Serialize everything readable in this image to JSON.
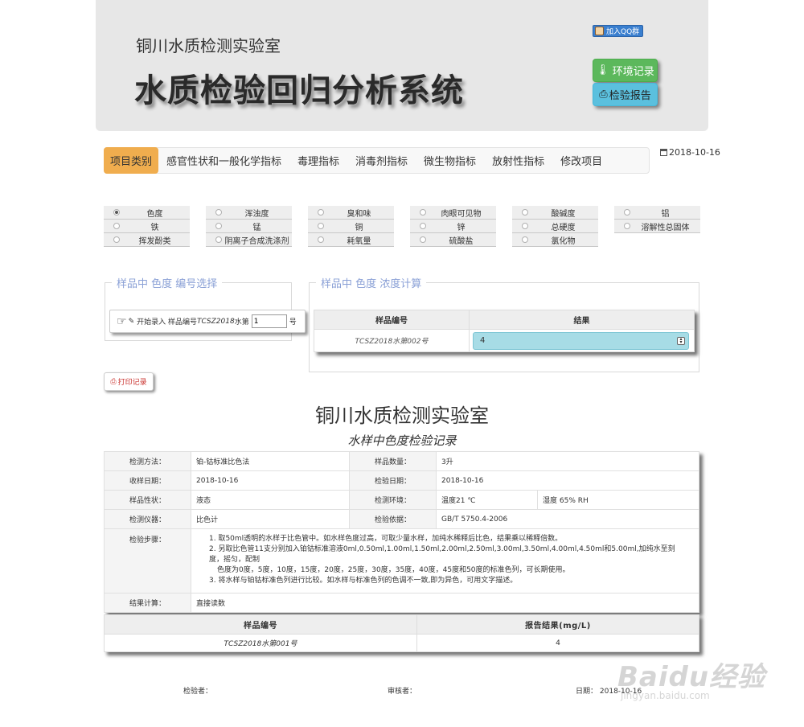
{
  "header": {
    "lab_name": "铜川水质检测实验室",
    "system_title": "水质检验回归分析系统",
    "qq_button": "加入QQ群",
    "env_button": "环境记录",
    "report_button": "检验报告"
  },
  "tabs": {
    "active": "项目类别",
    "items": [
      "感官性状和一般化学指标",
      "毒理指标",
      "消毒剂指标",
      "微生物指标",
      "放射性指标",
      "修改项目"
    ]
  },
  "date_top": "2018-10-16",
  "radio_items": [
    {
      "label": "色度",
      "checked": true
    },
    {
      "label": "浑浊度",
      "checked": false
    },
    {
      "label": "臭和味",
      "checked": false
    },
    {
      "label": "肉眼可见物",
      "checked": false
    },
    {
      "label": "酸碱度",
      "checked": false
    },
    {
      "label": "铝",
      "checked": false
    },
    {
      "label": "铁",
      "checked": false
    },
    {
      "label": "锰",
      "checked": false
    },
    {
      "label": "铜",
      "checked": false
    },
    {
      "label": "锌",
      "checked": false
    },
    {
      "label": "总硬度",
      "checked": false
    },
    {
      "label": "溶解性总固体",
      "checked": false
    },
    {
      "label": "挥发酚类",
      "checked": false
    },
    {
      "label": "阴离子合成洗涤剂",
      "checked": false
    },
    {
      "label": "耗氧量",
      "checked": false
    },
    {
      "label": "硫酸盐",
      "checked": false
    },
    {
      "label": "氯化物",
      "checked": false
    }
  ],
  "select_panel": {
    "legend": "样品中 色度 编号选择",
    "prefix": "开始录入 样品编号",
    "sample_prefix": "TCSZ2018",
    "water_label": "水第",
    "number_value": "1",
    "suffix": "号"
  },
  "calc_panel": {
    "legend": "样品中 色度 浓度计算",
    "col_sample": "样品编号",
    "col_result": "结果",
    "sample_id": "TCSZ2018水第002号",
    "result_value": "4"
  },
  "print_button": "打印记录",
  "record": {
    "title": "铜川水质检测实验室",
    "subtitle": "水样中色度检验记录",
    "rows": {
      "method_label": "检测方法：",
      "method_value": "铂-钴标准比色法",
      "qty_label": "样品数量：",
      "qty_value": "3升",
      "recv_label": "收样日期：",
      "recv_value": "2018-10-16",
      "test_date_label": "检验日期：",
      "test_date_value": "2018-10-16",
      "prop_label": "样品性状：",
      "prop_value": "液态",
      "env_label": "检测环境：",
      "temp_value": "温度21 ℃",
      "humidity_value": "湿度 65% RH",
      "instrument_label": "检测仪器：",
      "instrument_value": "比色计",
      "basis_label": "检验依据：",
      "basis_value": "GB/T 5750.4-2006",
      "steps_label": "检验步骤：",
      "step1": "1. 取50ml透明的水样于比色管中。如水样色度过高，可取少量水样，加纯水稀释后比色，结果乘以稀释倍数。",
      "step2a": "2. 另取比色管11支分别加入铂钴标准溶液0ml,0.50ml,1.00ml,1.50ml,2.00ml,2.50ml,3.00ml,3.50ml,4.00ml,4.50ml和5.00ml,加纯水至刻度，摇匀，配制",
      "step2b": "色度为0度，5度，10度，15度，20度，25度，30度，35度，40度，45度和50度的标准色列，可长期使用。",
      "step3": "3. 将水样与铂钴标准色列进行比较。如水样与标准色列的色调不一致,即为异色，可用文字描述。",
      "calc_label": "结果计算：",
      "calc_value": "直接读数"
    }
  },
  "result": {
    "col_sample": "样品编号",
    "col_result": "报告结果(mg/L)",
    "sample_id": "TCSZ2018水第001号",
    "value": "4"
  },
  "footer": {
    "inspector": "检验者：",
    "reviewer": "审核者：",
    "date_label": "日期：",
    "date_value": "2018-10-16"
  },
  "watermark": {
    "logo_text": "Baidu经验",
    "url": "jingyan.baidu.com"
  }
}
